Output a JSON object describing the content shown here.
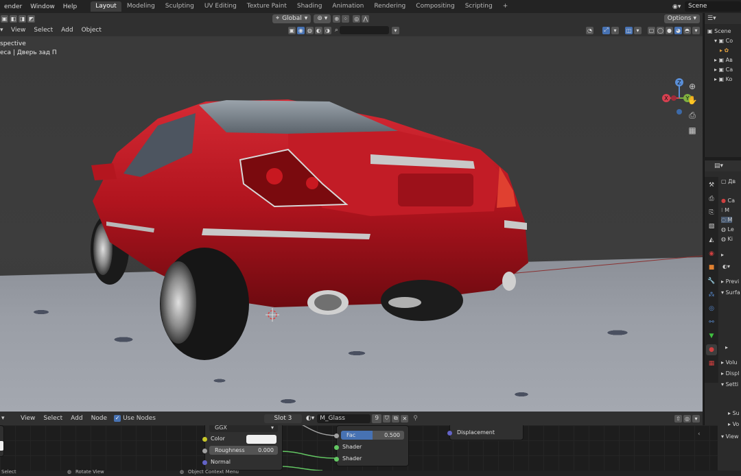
{
  "menubar": {
    "items": [
      "ender",
      "Window",
      "Help"
    ],
    "workspaces": [
      "Layout",
      "Modeling",
      "Sculpting",
      "UV Editing",
      "Texture Paint",
      "Shading",
      "Animation",
      "Rendering",
      "Compositing",
      "Scripting",
      "+"
    ],
    "active_workspace": "Layout",
    "scene": "Scene"
  },
  "viewport_header": {
    "menus": [
      "View",
      "Select",
      "Add",
      "Object"
    ],
    "orientation": "Global",
    "options": "Options"
  },
  "viewport_overlay": {
    "mode": "spective",
    "object": "еса | Дверь зад П"
  },
  "gizmo": {
    "z": "Z",
    "y": "Y",
    "x": "X"
  },
  "outliner": {
    "rows": [
      "Scene",
      "Co",
      "",
      "Ав",
      "Ca",
      "Ko"
    ]
  },
  "properties": {
    "header": "Дв",
    "material_slots": [
      "Ca",
      "M",
      "M",
      "Le",
      "Ki"
    ],
    "sections": [
      "Previ",
      "Surfa",
      "Volu",
      "Displ",
      "Setti",
      "Su",
      "Vo",
      "View"
    ]
  },
  "node_header": {
    "menus": [
      "View",
      "Select",
      "Add",
      "Node"
    ],
    "use_nodes": "Use Nodes",
    "slot": "Slot 3",
    "material": "M_Glass",
    "users": "9"
  },
  "nodes": {
    "bsdf": {
      "distribution": "GGX",
      "color_label": "Color",
      "roughness_label": "Roughness",
      "roughness_value": "0.000",
      "normal_label": "Normal"
    },
    "mix": {
      "fac_label": "Fac",
      "fac_value": "0.500",
      "shader1": "Shader",
      "shader2": "Shader"
    },
    "output": {
      "displacement": "Displacement"
    }
  },
  "statusbar": {
    "left": "Select",
    "mid": "Rotate View",
    "right": "Object Context Menu"
  },
  "colors": {
    "accent": "#4772b3",
    "car_red": "#b0141e",
    "socket_green": "#63c763",
    "socket_yellow": "#c7c729",
    "socket_gray": "#a1a1a1",
    "socket_purple": "#6363c7"
  }
}
